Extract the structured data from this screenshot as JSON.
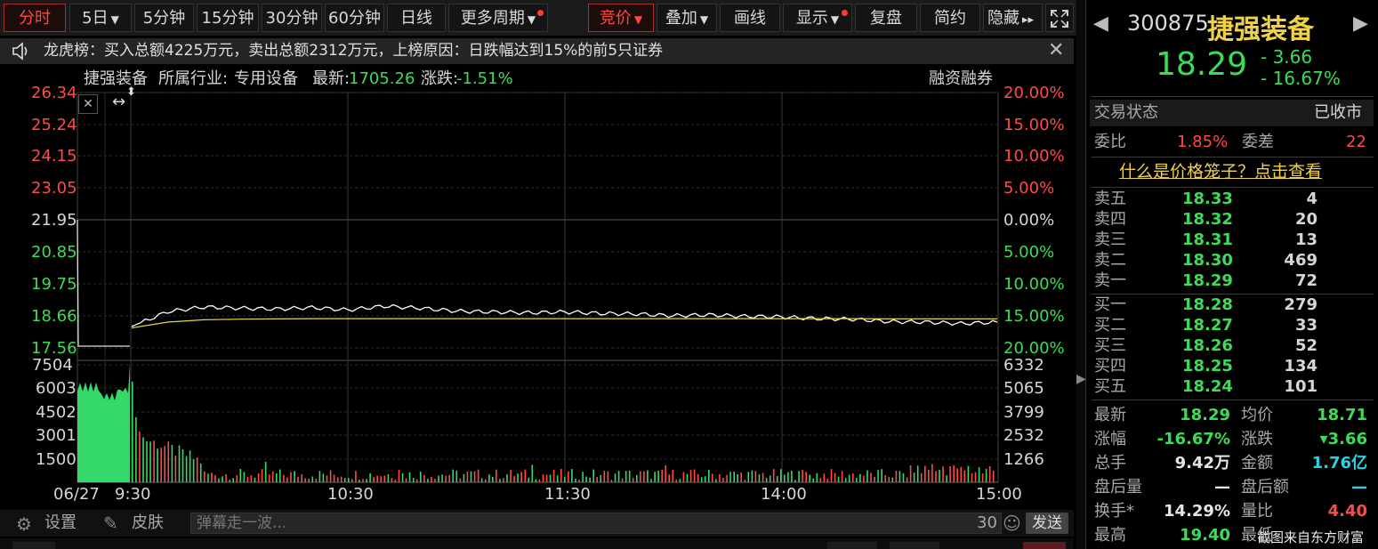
{
  "toolbar": {
    "periods": [
      "分时",
      "5日",
      "5分钟",
      "15分钟",
      "30分钟",
      "60分钟",
      "日线",
      "更多周期"
    ],
    "tools": [
      "竞价",
      "叠加",
      "画线",
      "显示",
      "复盘",
      "简约",
      "隐藏"
    ],
    "hide_arrow": "▸▸"
  },
  "notice": {
    "text": "龙虎榜：买入总额4225万元，卖出总额2312万元，上榜原因：日跌幅达到15%的前5只证券"
  },
  "info_bar": {
    "name": "捷强装备",
    "industry_label": "所属行业:",
    "industry": "专用设备",
    "latest_label": "最新:",
    "latest": "1705.26",
    "change_label": "涨跌:",
    "change": "-1.51%",
    "margin": "融资融券"
  },
  "chart_data": [
    {
      "type": "line",
      "y_left_ticks": [
        "26.34",
        "25.24",
        "24.15",
        "23.05",
        "21.95",
        "20.85",
        "19.75",
        "18.66",
        "17.56"
      ],
      "y_right_ticks": [
        "20.00%",
        "15.00%",
        "10.00%",
        "5.00%",
        "0.00%",
        "5.00%",
        "10.00%",
        "15.00%",
        "20.00%"
      ],
      "x_ticks": [
        "06/27",
        "9:30",
        "10:30",
        "11:30",
        "14:00",
        "15:00"
      ],
      "ylim": [
        17.56,
        26.34
      ],
      "series": [
        {
          "values": [
            18.45,
            18.96,
            19.12,
            19.08,
            19.05,
            19.1,
            19.02,
            19.15,
            19.08,
            18.98,
            18.95,
            18.92,
            18.95,
            18.9,
            18.88,
            18.82,
            18.85,
            18.8,
            18.78,
            18.72,
            18.7,
            18.62,
            18.6,
            18.55,
            18.6
          ],
          "color": "#ffffff"
        },
        {
          "values": [
            18.4,
            18.6,
            18.68,
            18.7,
            18.71,
            18.72,
            18.72,
            18.72,
            18.72,
            18.72,
            18.72,
            18.72,
            18.72,
            18.72,
            18.72,
            18.72,
            18.72,
            18.72,
            18.72,
            18.72,
            18.72,
            18.71,
            18.71,
            18.71,
            18.71
          ],
          "color": "#e8d44d"
        }
      ]
    },
    {
      "type": "bar",
      "y_left_ticks": [
        "7504",
        "6003",
        "4502",
        "3001",
        "1500"
      ],
      "y_right_ticks": [
        "6332",
        "5065",
        "3799",
        "2532",
        "1266"
      ],
      "ylim": [
        0,
        7504
      ]
    }
  ],
  "controls": {
    "settings": "设置",
    "skin": "皮肤",
    "danmu_placeholder": "弹幕走一波...",
    "count": "30",
    "send": "发送"
  },
  "right": {
    "code": "300875",
    "name": "捷强装备",
    "price": "18.29",
    "chg": "- 3.66",
    "chg_pct": "- 16.67%",
    "trade_status_label": "交易状态",
    "trade_status": "已收市",
    "weibi_label": "委比",
    "weibi": "1.85%",
    "weicha_label": "委差",
    "weicha": "22",
    "cage_link": "什么是价格笼子？点击查看",
    "asks": [
      {
        "label": "卖五",
        "price": "18.33",
        "vol": "4"
      },
      {
        "label": "卖四",
        "price": "18.32",
        "vol": "20"
      },
      {
        "label": "卖三",
        "price": "18.31",
        "vol": "13"
      },
      {
        "label": "卖二",
        "price": "18.30",
        "vol": "469"
      },
      {
        "label": "卖一",
        "price": "18.29",
        "vol": "72"
      }
    ],
    "bids": [
      {
        "label": "买一",
        "price": "18.28",
        "vol": "279"
      },
      {
        "label": "买二",
        "price": "18.27",
        "vol": "33"
      },
      {
        "label": "买三",
        "price": "18.26",
        "vol": "52"
      },
      {
        "label": "买四",
        "price": "18.25",
        "vol": "134"
      },
      {
        "label": "买五",
        "price": "18.24",
        "vol": "101"
      }
    ],
    "stats": [
      {
        "l1": "最新",
        "v1": "18.29",
        "c1": "green",
        "l2": "均价",
        "v2": "18.71",
        "c2": "green"
      },
      {
        "l1": "涨幅",
        "v1": "-16.67%",
        "c1": "green",
        "l2": "涨跌",
        "v2": "▾3.66",
        "c2": "green"
      },
      {
        "l1": "总手",
        "v1": "9.42万",
        "c1": "white",
        "l2": "金额",
        "v2": "1.76亿",
        "c2": "cyan"
      },
      {
        "l1": "盘后量",
        "v1": "—",
        "c1": "white",
        "l2": "盘后额",
        "v2": "—",
        "c2": "cyan"
      },
      {
        "l1": "换手*",
        "v1": "14.29%",
        "c1": "white",
        "l2": "量比",
        "v2": "4.40",
        "c2": "red"
      },
      {
        "l1": "最高",
        "v1": "19.40",
        "c1": "green",
        "l2": "最低",
        "v2": "",
        "c2": "green"
      }
    ],
    "watermark": "截图来自东方财富"
  }
}
